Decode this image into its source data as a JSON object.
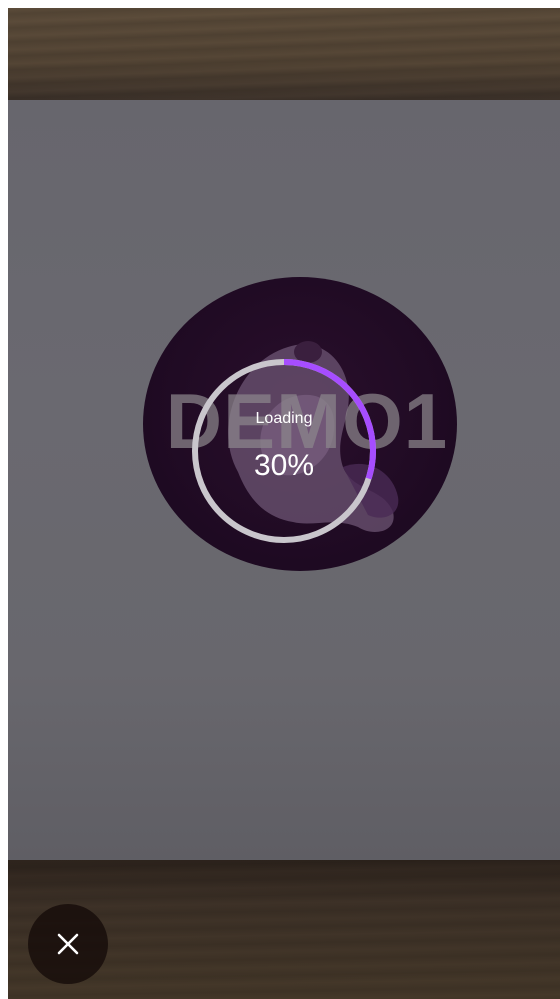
{
  "marker": {
    "text": "DEMO1"
  },
  "loading": {
    "label": "Loading",
    "percent_text": "30%",
    "progress": 0.3,
    "accent_color": "#a64dff",
    "track_color": "#c9c6cc"
  },
  "close_button": {
    "icon": "close-icon"
  }
}
